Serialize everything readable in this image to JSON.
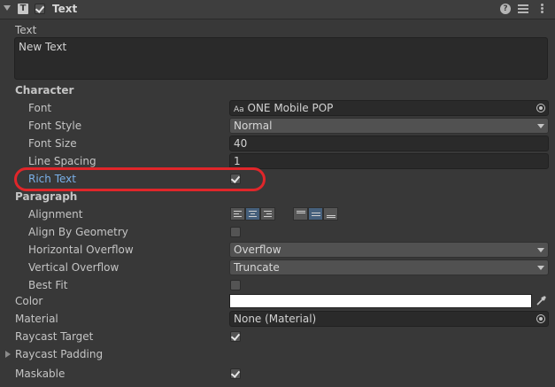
{
  "component": {
    "title": "Text",
    "type_icon": "T",
    "enabled": true
  },
  "header_icons": {
    "help": "?",
    "presets": "presets-icon",
    "more": "more-icon"
  },
  "text_field": {
    "label": "Text",
    "value": "New Text"
  },
  "character": {
    "heading": "Character",
    "font": {
      "label": "Font",
      "prefix": "Aa",
      "value": "ONE Mobile POP"
    },
    "font_style": {
      "label": "Font Style",
      "value": "Normal"
    },
    "font_size": {
      "label": "Font Size",
      "value": "40"
    },
    "line_spacing": {
      "label": "Line Spacing",
      "value": "1"
    },
    "rich_text": {
      "label": "Rich Text",
      "checked": true
    }
  },
  "paragraph": {
    "heading": "Paragraph",
    "alignment": {
      "label": "Alignment",
      "horizontal_selected": "center",
      "vertical_selected": "middle"
    },
    "align_by_geometry": {
      "label": "Align By Geometry",
      "checked": false
    },
    "horizontal_overflow": {
      "label": "Horizontal Overflow",
      "value": "Overflow"
    },
    "vertical_overflow": {
      "label": "Vertical Overflow",
      "value": "Truncate"
    },
    "best_fit": {
      "label": "Best Fit",
      "checked": false
    }
  },
  "color": {
    "label": "Color",
    "value": "#ffffff"
  },
  "material": {
    "label": "Material",
    "value": "None (Material)"
  },
  "raycast_target": {
    "label": "Raycast Target",
    "checked": true
  },
  "raycast_padding": {
    "label": "Raycast Padding"
  },
  "maskable": {
    "label": "Maskable",
    "checked": true
  },
  "colors": {
    "background": "#383838",
    "highlight": "#e0262a",
    "rich_text_label": "#7ab0e8"
  }
}
